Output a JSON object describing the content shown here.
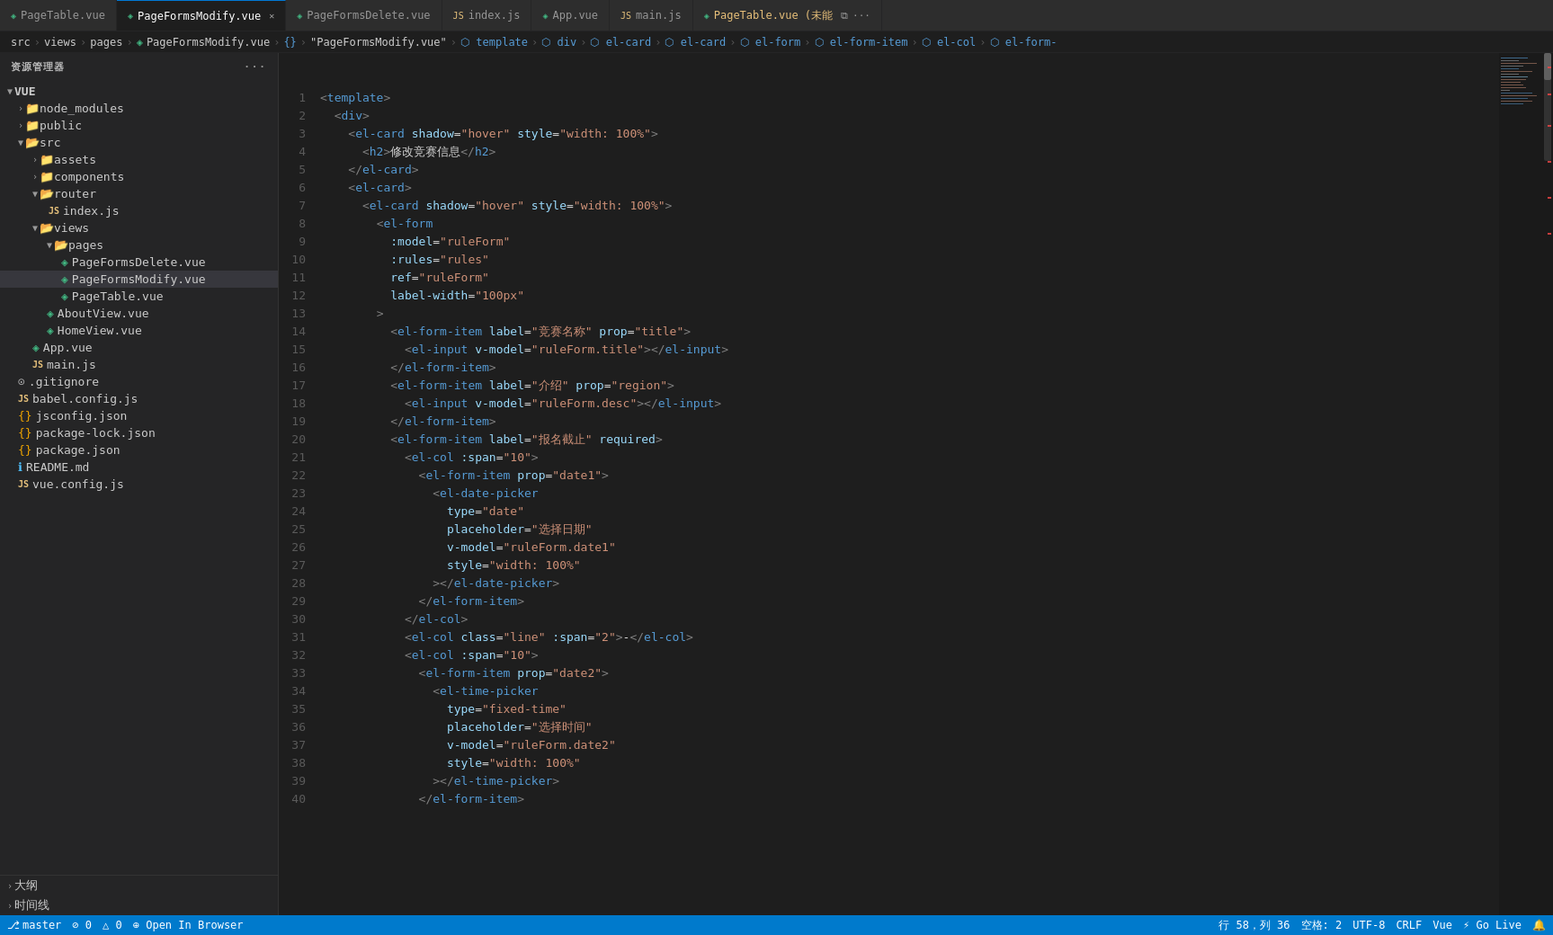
{
  "app": {
    "title": "资源管理器"
  },
  "tabs": [
    {
      "id": "PageTable",
      "label": "PageTable.vue",
      "icon": "vue",
      "active": false,
      "modified": false,
      "closable": false
    },
    {
      "id": "PageFormsModify",
      "label": "PageFormsModify.vue",
      "icon": "vue",
      "active": true,
      "modified": false,
      "closable": true
    },
    {
      "id": "PageFormsDelete",
      "label": "PageFormsDelete.vue",
      "icon": "vue",
      "active": false,
      "modified": false,
      "closable": false
    },
    {
      "id": "index.js",
      "label": "index.js",
      "icon": "js",
      "active": false,
      "modified": false,
      "closable": false
    },
    {
      "id": "App.vue",
      "label": "App.vue",
      "icon": "vue",
      "active": false,
      "modified": false,
      "closable": false
    },
    {
      "id": "main.js",
      "label": "main.js",
      "icon": "js",
      "active": false,
      "modified": false,
      "closable": false
    },
    {
      "id": "PageTable2",
      "label": "PageTable.vue (未能",
      "icon": "vue",
      "active": false,
      "modified": true,
      "closable": false
    }
  ],
  "breadcrumb": [
    {
      "text": "src",
      "type": "folder"
    },
    {
      "text": "views",
      "type": "folder"
    },
    {
      "text": "pages",
      "type": "folder"
    },
    {
      "text": "PageFormsModify.vue",
      "icon": "vue",
      "type": "file"
    },
    {
      "text": "{}",
      "type": "tag"
    },
    {
      "text": "\"PageFormsModify.vue\"",
      "type": "string"
    },
    {
      "text": "⬡",
      "type": "tag"
    },
    {
      "text": "template",
      "type": "tag"
    },
    {
      "text": "⬡",
      "type": "tag"
    },
    {
      "text": "div",
      "type": "tag"
    },
    {
      "text": "⬡",
      "type": "tag"
    },
    {
      "text": "el-card",
      "type": "tag"
    },
    {
      "text": "⬡",
      "type": "tag"
    },
    {
      "text": "el-card",
      "type": "tag"
    },
    {
      "text": "⬡",
      "type": "tag"
    },
    {
      "text": "el-form",
      "type": "tag"
    },
    {
      "text": "⬡",
      "type": "tag"
    },
    {
      "text": "el-form-item",
      "type": "tag"
    },
    {
      "text": "⬡",
      "type": "tag"
    },
    {
      "text": "el-col",
      "type": "tag"
    },
    {
      "text": "⬡",
      "type": "tag"
    },
    {
      "text": "el-form-",
      "type": "tag"
    }
  ],
  "sidebar": {
    "header": "资源管理器",
    "project": "VUE",
    "tree": [
      {
        "id": "node_modules",
        "label": "node_modules",
        "type": "folder",
        "depth": 1,
        "collapsed": true
      },
      {
        "id": "public",
        "label": "public",
        "type": "folder",
        "depth": 1,
        "collapsed": true
      },
      {
        "id": "src",
        "label": "src",
        "type": "folder",
        "depth": 1,
        "collapsed": false
      },
      {
        "id": "assets",
        "label": "assets",
        "type": "folder",
        "depth": 2,
        "collapsed": true
      },
      {
        "id": "components",
        "label": "components",
        "type": "folder",
        "depth": 2,
        "collapsed": true
      },
      {
        "id": "router",
        "label": "router",
        "type": "folder",
        "depth": 2,
        "collapsed": false
      },
      {
        "id": "index.js_router",
        "label": "index.js",
        "type": "js",
        "depth": 3
      },
      {
        "id": "views",
        "label": "views",
        "type": "folder",
        "depth": 2,
        "collapsed": false
      },
      {
        "id": "pages",
        "label": "pages",
        "type": "folder",
        "depth": 3,
        "collapsed": false
      },
      {
        "id": "PageFormsDelete.vue",
        "label": "PageFormsDelete.vue",
        "type": "vue",
        "depth": 4
      },
      {
        "id": "PageFormsModify.vue",
        "label": "PageFormsModify.vue",
        "type": "vue",
        "depth": 4,
        "selected": true
      },
      {
        "id": "PageTable.vue",
        "label": "PageTable.vue",
        "type": "vue",
        "depth": 4
      },
      {
        "id": "AboutView.vue",
        "label": "AboutView.vue",
        "type": "vue",
        "depth": 3
      },
      {
        "id": "HomeView.vue",
        "label": "HomeView.vue",
        "type": "vue",
        "depth": 3
      },
      {
        "id": "App.vue",
        "label": "App.vue",
        "type": "vue",
        "depth": 2
      },
      {
        "id": "main.js",
        "label": "main.js",
        "type": "js",
        "depth": 2
      },
      {
        "id": ".gitignore",
        "label": ".gitignore",
        "type": "git",
        "depth": 1
      },
      {
        "id": "babel.config.js",
        "label": "babel.config.js",
        "type": "js",
        "depth": 1
      },
      {
        "id": "jsconfig.json",
        "label": "jsconfig.json",
        "type": "json",
        "depth": 1
      },
      {
        "id": "package-lock.json",
        "label": "package-lock.json",
        "type": "json",
        "depth": 1
      },
      {
        "id": "package.json",
        "label": "package.json",
        "type": "json",
        "depth": 1
      },
      {
        "id": "README.md",
        "label": "README.md",
        "type": "md",
        "depth": 1
      },
      {
        "id": "vue.config.js",
        "label": "vue.config.js",
        "type": "js",
        "depth": 1
      }
    ]
  },
  "code_lines": [
    {
      "ln": 1,
      "content": "<template>"
    },
    {
      "ln": 2,
      "content": "  <div>"
    },
    {
      "ln": 3,
      "content": "    <el-card shadow=\"hover\" style=\"width: 100%\">"
    },
    {
      "ln": 4,
      "content": "      <h2>修改竞赛信息</h2>"
    },
    {
      "ln": 5,
      "content": "    </el-card>"
    },
    {
      "ln": 6,
      "content": "    <el-card>"
    },
    {
      "ln": 7,
      "content": "      <el-card shadow=\"hover\" style=\"width: 100%\">"
    },
    {
      "ln": 8,
      "content": "        <el-form"
    },
    {
      "ln": 9,
      "content": "          :model=\"ruleForm\""
    },
    {
      "ln": 10,
      "content": "          :rules=\"rules\""
    },
    {
      "ln": 11,
      "content": "          ref=\"ruleForm\""
    },
    {
      "ln": 12,
      "content": "          label-width=\"100px\""
    },
    {
      "ln": 13,
      "content": "        >"
    },
    {
      "ln": 14,
      "content": "          <el-form-item label=\"竞赛名称\" prop=\"title\">"
    },
    {
      "ln": 15,
      "content": "            <el-input v-model=\"ruleForm.title\"></el-input>"
    },
    {
      "ln": 16,
      "content": "          </el-form-item>"
    },
    {
      "ln": 17,
      "content": "          <el-form-item label=\"介绍\" prop=\"region\">"
    },
    {
      "ln": 18,
      "content": "            <el-input v-model=\"ruleForm.desc\"></el-input>"
    },
    {
      "ln": 19,
      "content": "          </el-form-item>"
    },
    {
      "ln": 20,
      "content": "          <el-form-item label=\"报名截止\" required>"
    },
    {
      "ln": 21,
      "content": "            <el-col :span=\"10\">"
    },
    {
      "ln": 22,
      "content": "              <el-form-item prop=\"date1\">"
    },
    {
      "ln": 23,
      "content": "                <el-date-picker"
    },
    {
      "ln": 24,
      "content": "                  type=\"date\""
    },
    {
      "ln": 25,
      "content": "                  placeholder=\"选择日期\""
    },
    {
      "ln": 26,
      "content": "                  v-model=\"ruleForm.date1\""
    },
    {
      "ln": 27,
      "content": "                  style=\"width: 100%\""
    },
    {
      "ln": 28,
      "content": "                ></el-date-picker>"
    },
    {
      "ln": 29,
      "content": "              </el-form-item>"
    },
    {
      "ln": 30,
      "content": "            </el-col>"
    },
    {
      "ln": 31,
      "content": "            <el-col class=\"line\" :span=\"2\">-</el-col>"
    },
    {
      "ln": 32,
      "content": "            <el-col :span=\"10\">"
    },
    {
      "ln": 33,
      "content": "              <el-form-item prop=\"date2\">"
    },
    {
      "ln": 34,
      "content": "                <el-time-picker"
    },
    {
      "ln": 35,
      "content": "                  type=\"fixed-time\""
    },
    {
      "ln": 36,
      "content": "                  placeholder=\"选择时间\""
    },
    {
      "ln": 37,
      "content": "                  v-model=\"ruleForm.date2\""
    },
    {
      "ln": 38,
      "content": "                  style=\"width: 100%\""
    },
    {
      "ln": 39,
      "content": "                ></el-time-picker>"
    },
    {
      "ln": 40,
      "content": "              </el-form-item>"
    }
  ],
  "status_bar": {
    "branch": "master",
    "errors": "⊘ 0",
    "warnings": "△ 0",
    "open_browser": "⊕ Open In Browser",
    "position": "行 58，列 36",
    "spaces": "空格: 2",
    "encoding": "UTF-8",
    "line_ending": "CRLF",
    "language": "Vue",
    "live_server": "⚡ Go Live",
    "notification": "🔔"
  },
  "bottom_panel": {
    "items": [
      "大纲",
      "时间线"
    ]
  }
}
